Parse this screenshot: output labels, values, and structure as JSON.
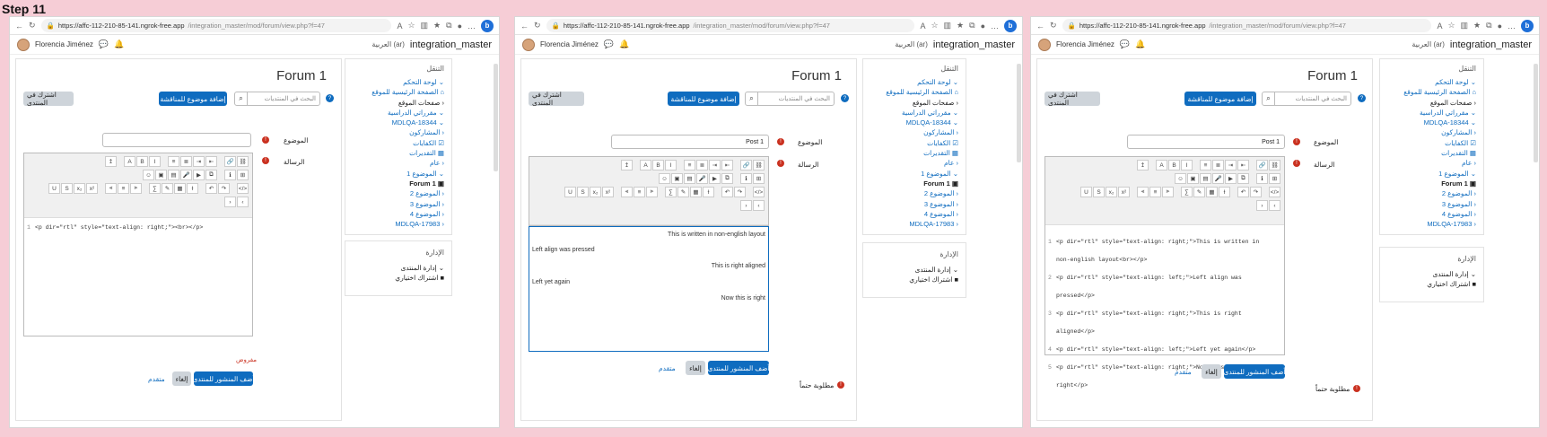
{
  "step_label": "Step 11",
  "browser": {
    "url_host": "https://affc-112-210-85-141.ngrok-free.app",
    "url_path": "/integration_master/mod/forum/view.php?f=47",
    "bing": "b"
  },
  "header": {
    "user_name": "Florencia Jiménez",
    "language": "العربية (ar)",
    "site_name": "integration_master"
  },
  "page": {
    "title": "Forum 1",
    "subscribe_button": "اشترك في المنتدى",
    "add_topic_button": "إضافة موضوع للمناقشة",
    "search_placeholder": "البحث في المنتديات",
    "subject_label": "الموضوع",
    "message_label": "الرسالة",
    "subject_value_empty": "",
    "subject_value": "Post 1",
    "required_note": "مطلوبة حتماً",
    "required_star_note": "مفروض",
    "post_button": "أضف المنشور للمنتدى",
    "cancel_button": "إلغاء",
    "advanced_link": "متقدم"
  },
  "editor": {
    "source_w1": "<p dir=\"rtl\" style=\"text-align: right;\"><br></p>",
    "wysiwyg_lines": [
      "This is written in non-english layout",
      "Left align was pressed",
      "This is right aligned",
      "Left yet again",
      "Now this is right"
    ],
    "source_lines_w3": [
      "1",
      "<p dir=\"rtl\" style=\"text-align: right;\">This is written in",
      "non-english layout<br></p>",
      "2",
      "<p dir=\"rtl\" style=\"text-align: left;\">Left align was",
      "pressed</p>",
      "3",
      "<p dir=\"rtl\" style=\"text-align: right;\">This is right",
      "aligned</p>",
      "4",
      "<p dir=\"rtl\" style=\"text-align: left;\">Left yet again</p>",
      "5",
      "<p dir=\"rtl\" style=\"text-align: right;\">Now this is",
      "right</p>"
    ],
    "toolbar_icons": [
      "undo-icon",
      "redo-icon",
      "html-icon",
      "bold-icon",
      "italic-icon",
      "list-icon",
      "link-icon",
      "image-icon",
      "media-icon"
    ]
  },
  "sidebar": {
    "nav_title": "التنقل",
    "items": [
      "لوحة التحكم",
      "الصفحة الرئيسية للموقع",
      "صفحات الموقع",
      "مقرراتي الدراسية",
      "MDLQA-18344",
      "المشاركون",
      "الكفايات",
      "التقديرات",
      "عام",
      "الموضوع 1",
      "Forum 1",
      "الموضوع 2",
      "الموضوع 3",
      "الموضوع 4",
      "MDLQA-17983"
    ],
    "admin_title": "الإدارة",
    "admin_items": [
      "إدارة المنتدى",
      "اشتراك اختياري"
    ]
  }
}
